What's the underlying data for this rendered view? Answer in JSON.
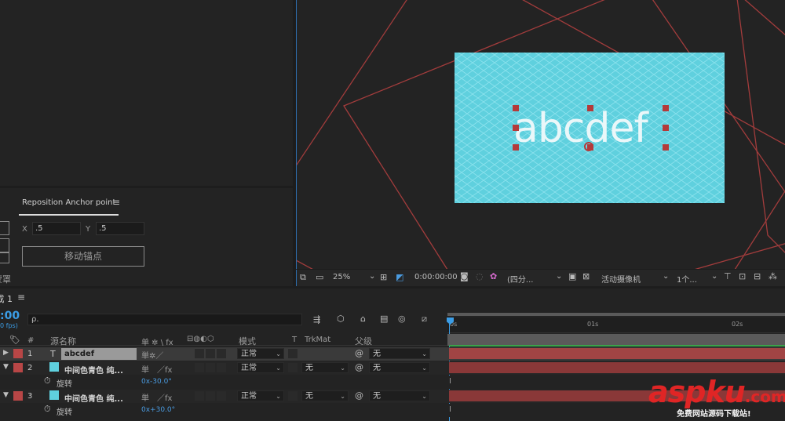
{
  "effect_panel": {
    "tab_label": "Reposition Anchor point",
    "x_label": "X",
    "x_value": ".5",
    "y_label": "Y",
    "y_value": ".5",
    "move_button": "移动锚点",
    "cut_text": "蒙罩"
  },
  "comp_view": {
    "text": "abcdef",
    "zoom": "25%",
    "timecode": "0:00:00:00",
    "channel": "(四分...",
    "camera": "活动摄像机",
    "views": "1个..."
  },
  "timeline": {
    "tab": "成 1",
    "timecode": ":00",
    "fps": "0 fps)",
    "search_placeholder": "ρ.",
    "headers": {
      "num": "#",
      "source": "源名称",
      "switches": "单 ✲ \\ fx",
      "mode": "模式",
      "t": "T",
      "trkmat": "TrkMat",
      "parent": "父级"
    },
    "ruler": [
      "0s",
      "01s",
      "02s"
    ],
    "layers": [
      {
        "num": "1",
        "type": "T",
        "name": "abcdef",
        "mode": "正常",
        "trkmat": "",
        "parent": "无",
        "color": "#b84646"
      },
      {
        "num": "2",
        "type": "solid",
        "name": "中间色青色 纯...",
        "mode": "正常",
        "trkmat": "无",
        "parent": "无",
        "color": "#b84646",
        "prop_name": "旋转",
        "prop_value": "0x-30.0°"
      },
      {
        "num": "3",
        "type": "solid",
        "name": "中间色青色 纯...",
        "mode": "正常",
        "trkmat": "无",
        "parent": "无",
        "color": "#b84646",
        "prop_name": "旋转",
        "prop_value": "0x+30.0°"
      }
    ]
  },
  "watermark": {
    "brand": "aspku",
    "tld": ".com",
    "tagline": "免费网站源码下载站!"
  },
  "colors": {
    "accent_blue": "#2e8ad8",
    "layer_red": "#b84646",
    "solid_cyan": "#5fd0de",
    "guide_red": "#a23c3c"
  }
}
